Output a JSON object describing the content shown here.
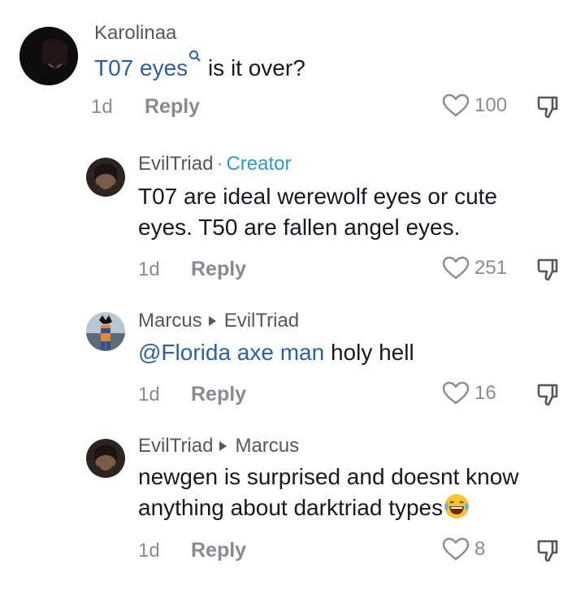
{
  "comments": [
    {
      "username": "Karolinaa",
      "text_link": "T07 eyes",
      "text": " is it over?",
      "time": "1d",
      "reply": "Reply",
      "likes": "100"
    },
    {
      "username": "EvilTriad",
      "separator": "·",
      "badge": "Creator",
      "text_line1": "T07 are ideal werewolf eyes or cute",
      "text_line2": "eyes. T50 are fallen angel eyes.",
      "time": "1d",
      "reply": "Reply",
      "likes": "251"
    },
    {
      "username": "Marcus",
      "reply_to": "EvilTriad",
      "mention": "@Florida axe man",
      "text": " holy hell",
      "time": "1d",
      "reply": "Reply",
      "likes": "16"
    },
    {
      "username": "EvilTriad",
      "reply_to": "Marcus",
      "text_line1": "newgen is surprised and doesnt know",
      "text_line2": "anything about darktriad types",
      "emoji": "laughing-tears-emoji",
      "time": "1d",
      "reply": "Reply",
      "likes": "8"
    }
  ],
  "icons": {
    "like": "heart-outline-icon",
    "dislike": "thumbs-down-icon",
    "search_hint": "search-icon"
  },
  "colors": {
    "link": "#2c5fa8",
    "creator_badge": "#2b9cc9",
    "muted": "#8a8b91"
  }
}
